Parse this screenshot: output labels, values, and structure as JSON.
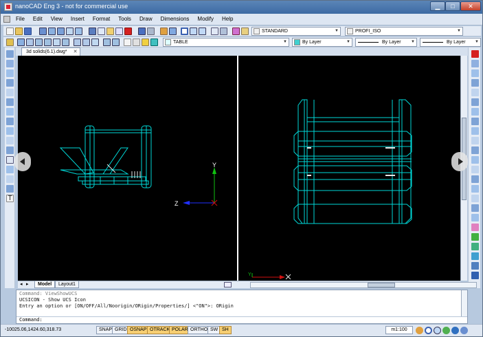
{
  "window": {
    "title": "nanoCAD Eng 3 - not for commercial use",
    "min_glyph": "▁",
    "max_glyph": "□",
    "close_glyph": "✕"
  },
  "menu": [
    "File",
    "Edit",
    "View",
    "Insert",
    "Format",
    "Tools",
    "Draw",
    "Dimensions",
    "Modify",
    "Help"
  ],
  "toolbar": {
    "text_style": "STANDARD",
    "dim_style": "PROFI_ISO",
    "table_style": "TABLE",
    "color": "By Layer",
    "linetype": "By Layer",
    "lineweight": "By Layer"
  },
  "document_tab": {
    "label": "3d solids(6.1).dwg*",
    "close_glyph": "✕"
  },
  "layout_tabs": [
    "Model",
    "Layout1"
  ],
  "ucs": {
    "x": "X",
    "y": "Y",
    "z": "Z"
  },
  "command": {
    "history": [
      "Command: ViewShowUCS",
      "UCSICON - Show UCS Icon",
      "Entry an option or [ON/OFF/All/Noorigin/ORigin/Properties/] <\"ON\">: ORigin"
    ],
    "prompt": "Command:"
  },
  "status": {
    "coords": "-10025.06,1424.60,318.73",
    "buttons": [
      {
        "label": "SNAP",
        "on": false
      },
      {
        "label": "GRID",
        "on": false
      },
      {
        "label": "OSNAP",
        "on": true
      },
      {
        "label": "OTRACK",
        "on": true
      },
      {
        "label": "POLAR",
        "on": true
      },
      {
        "label": "ORTHO",
        "on": false
      },
      {
        "label": "SW",
        "on": false
      },
      {
        "label": "SH",
        "on": true
      }
    ],
    "scale": "m1:100"
  },
  "colors": {
    "wire": "#00d9d9",
    "viewport": "#000000",
    "axis_x": "#d01010",
    "axis_y": "#10c010",
    "axis_z": "#2030ff"
  }
}
